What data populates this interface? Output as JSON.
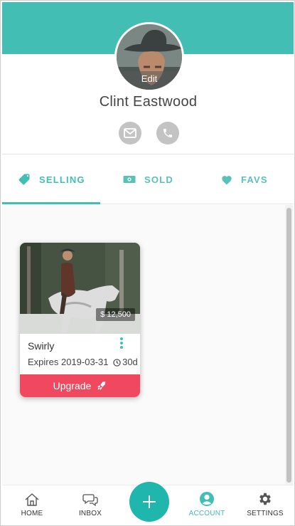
{
  "profile": {
    "name": "Clint Eastwood",
    "edit_label": "Edit"
  },
  "tabs": [
    {
      "label": "SELLING",
      "icon": "tag-icon",
      "selected": true
    },
    {
      "label": "SOLD",
      "icon": "money-icon",
      "selected": false
    },
    {
      "label": "FAVS",
      "icon": "heart-icon",
      "selected": false
    }
  ],
  "listing": {
    "title": "Swirly",
    "price": "$ 12,500",
    "expires": "Expires 2019-03-31",
    "duration": "30d",
    "upgrade_label": "Upgrade"
  },
  "nav": {
    "home": "HOME",
    "inbox": "INBOX",
    "account": "ACCOUNT",
    "settings": "SETTINGS"
  },
  "colors": {
    "accent": "#42beb4",
    "upgrade": "#f0495f",
    "fab": "#1fb6ad"
  }
}
